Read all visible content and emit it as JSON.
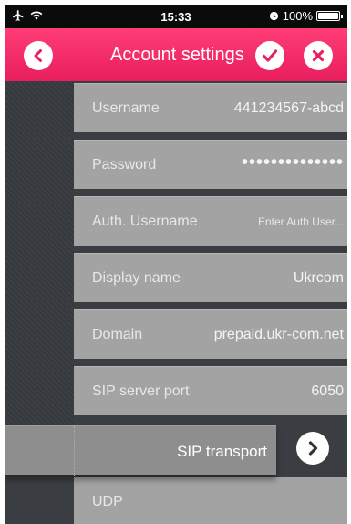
{
  "status_bar": {
    "time": "15:33",
    "battery": "100%",
    "battery_level": 1.0
  },
  "header": {
    "title": "Account settings",
    "back_icon": "chevron-left-icon",
    "confirm_icon": "check-icon",
    "close_icon": "x-icon",
    "accent_color": "#f0285f"
  },
  "fields": [
    {
      "label": "Username",
      "value": "441234567-abcd"
    },
    {
      "label": "Password",
      "value": "••••••••••••••"
    },
    {
      "label": "Auth. Username",
      "placeholder": "Enter Auth User..."
    },
    {
      "label": "Display name",
      "value": "Ukrcom"
    },
    {
      "label": "Domain",
      "value": "prepaid.ukr-com.net"
    },
    {
      "label": "SIP server port",
      "value": "6050"
    }
  ],
  "transport": {
    "label": "SIP transport",
    "selected": "UDP"
  }
}
